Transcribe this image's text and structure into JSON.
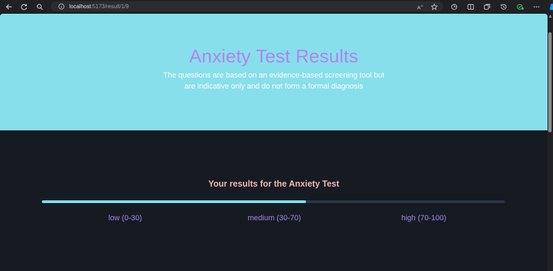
{
  "browser": {
    "url_host": "localhost",
    "url_path": ":5173/result/1/9"
  },
  "hero": {
    "title": "Anxiety Test Results",
    "subtitle": "The questions are based on an evidence-based screening tool but are indicative only and do not form a formal diagnosis"
  },
  "results": {
    "heading": "Your results for the Anxiety Test",
    "progress_percent": 57,
    "levels": [
      {
        "label": "low (0-30)"
      },
      {
        "label": "medium (30-70)"
      },
      {
        "label": "high (70-100)"
      }
    ]
  },
  "colors": {
    "hero_bg": "#87dfeb",
    "title": "#b382f0",
    "heading": "#f3b3b3",
    "progress_fill": "#7fe0ea",
    "level_label": "#a784f0",
    "page_bg": "#161b22"
  }
}
